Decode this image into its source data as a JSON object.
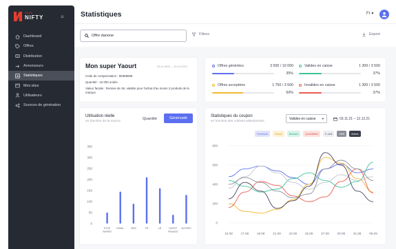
{
  "brand": {
    "small": "Fanch",
    "big": "NIFTY"
  },
  "sidebar": {
    "items": [
      {
        "label": "Dashboard",
        "icon": "home-icon"
      },
      {
        "label": "Offres",
        "icon": "tag-icon"
      },
      {
        "label": "Distribution",
        "icon": "share-icon"
      },
      {
        "label": "Annonceurs",
        "icon": "arrow-icon"
      },
      {
        "label": "Statistiques",
        "icon": "chart-icon",
        "active": true
      },
      {
        "label": "Mini sites",
        "icon": "browser-icon"
      },
      {
        "label": "Utilisateurs",
        "icon": "user-icon"
      },
      {
        "label": "Sources de génération",
        "icon": "source-icon"
      }
    ]
  },
  "header": {
    "title": "Statistiques",
    "language": "Fr"
  },
  "search": {
    "value": "Offre danone",
    "placeholder": ""
  },
  "toolbar": {
    "filters_label": "Filtres",
    "export_label": "Export"
  },
  "product": {
    "name": "Mon super Yaourt",
    "dates": "03.11.2021 – 10.12.2021",
    "code": "Code de compensation : 85389658",
    "quantity": "Quantité : 10 000 unités",
    "description": "Valeur faciale : Remise de 3€, valable pour l'achat d'au moins 2 produits de la marque"
  },
  "stats": [
    {
      "label": "Offres générées",
      "value": "3 500 / 10 000",
      "percent": "35%",
      "fraction": 0.35,
      "color": "#5b6ff0"
    },
    {
      "label": "Valides en caisse",
      "value": "1 300 / 3 500",
      "percent": "37%",
      "fraction": 0.37,
      "color": "#3cc39a"
    },
    {
      "label": "Offres acceptées",
      "value": "1 750 / 3 500",
      "percent": "50%",
      "fraction": 0.5,
      "color": "#f2b82e"
    },
    {
      "label": "Invalides en caisse",
      "value": "1 300 / 3 500",
      "percent": "37%",
      "fraction": 0.37,
      "color": "#ec5a4d"
    }
  ],
  "utilisation": {
    "title": "Utilisation réelle",
    "subtitle": "en fonction de la source",
    "toggle_quantity": "Quantité",
    "toggle_generosity": "Générosité"
  },
  "coupon": {
    "title": "Statistiques du coupon",
    "subtitle": "en fonction des critères sélectionnés",
    "select_value": "Valides en caisse",
    "date_range": "03.11.21 – 12.12.21",
    "legend": [
      {
        "label": "Facebook",
        "bg": "#dfe3fb",
        "fg": "#5b6ff0"
      },
      {
        "label": "Instore",
        "bg": "#fdf1d3",
        "fg": "#e0a622"
      },
      {
        "label": "Bourses",
        "bg": "#d7f3ea",
        "fg": "#2fa882"
      },
      {
        "label": "Quantifiable",
        "bg": "#fbe1de",
        "fg": "#e0524a"
      },
      {
        "label": "E-mail",
        "bg": "#eceef2",
        "fg": "#555a66"
      },
      {
        "label": "SMS",
        "bg": "#8c909b",
        "fg": "#ffffff"
      },
      {
        "label": "Autres",
        "bg": "#3a3e49",
        "fg": "#ffffff"
      }
    ]
  },
  "chart_data": [
    {
      "type": "bar",
      "title": "Utilisation réelle",
      "categories": [
        "STOP PAPIER",
        "EMAIL",
        "SMS",
        "FB",
        "LB",
        "OUEST FRANCE",
        "AUTRES"
      ],
      "values": [
        50,
        145,
        90,
        210,
        160,
        40,
        130
      ],
      "yticks": [
        0,
        50,
        100,
        150,
        200,
        250,
        300,
        350
      ],
      "ylim": [
        0,
        350
      ],
      "color": "#5b6ff0"
    },
    {
      "type": "line",
      "title": "Statistiques du coupon",
      "x": [
        "15.08",
        "17.08",
        "19.08",
        "21.08",
        "23.08",
        "25.08",
        "27.08",
        "29.08",
        "31.08",
        "06.09"
      ],
      "yticks": [
        0,
        200,
        400,
        600,
        800
      ],
      "ylim": [
        0,
        800
      ],
      "series": [
        {
          "name": "Facebook",
          "color": "#5b6ff0",
          "values": [
            480,
            560,
            590,
            540,
            470,
            400,
            560,
            610,
            520,
            560
          ]
        },
        {
          "name": "Instore",
          "color": "#f2b82e",
          "values": [
            200,
            120,
            100,
            140,
            240,
            400,
            680,
            620,
            460,
            320
          ]
        },
        {
          "name": "Bourses",
          "color": "#3cc39a",
          "values": [
            440,
            380,
            320,
            350,
            460,
            520,
            440,
            370,
            430,
            630
          ]
        },
        {
          "name": "Quantifiable",
          "color": "#ec5a4d",
          "values": [
            160,
            320,
            430,
            390,
            280,
            220,
            270,
            430,
            560,
            310
          ]
        },
        {
          "name": "E-mail",
          "color": "#c2c5cc",
          "values": [
            360,
            480,
            590,
            520,
            420,
            350,
            420,
            500,
            440,
            480
          ]
        },
        {
          "name": "SMS",
          "color": "#8c909b",
          "values": [
            400,
            470,
            420,
            330,
            260,
            300,
            560,
            650,
            560,
            440
          ]
        },
        {
          "name": "Autres",
          "color": "#4a3f5e",
          "values": [
            250,
            420,
            330,
            150,
            230,
            380,
            730,
            600,
            330,
            220
          ]
        }
      ]
    }
  ]
}
